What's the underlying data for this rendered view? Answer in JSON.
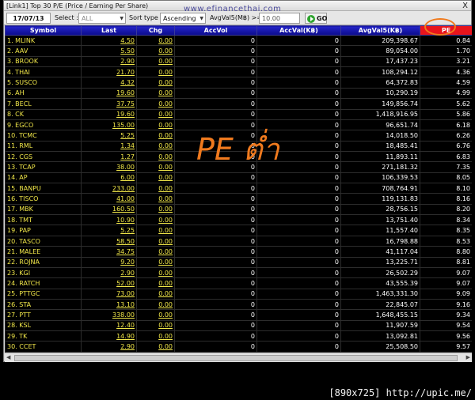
{
  "window": {
    "title": "[Link1] Top 30 P/E (Price / Earning Per Share)",
    "close": "X"
  },
  "watermark": "www.efinancethai.com",
  "toolbar": {
    "date": "17/07/13",
    "select_label": "Select :",
    "select_value": "ALL",
    "sort_label": "Sort type :",
    "sort_value": "Ascending",
    "avg_label": "AvgVal5(M฿) >=",
    "avg_value": "10.00",
    "go_label": "GO"
  },
  "table": {
    "columns": [
      "Symbol",
      "Last",
      "Chg",
      "AccVol",
      "AccVal(K฿)",
      "AvgVal5(K฿)",
      "PE"
    ],
    "rows": [
      [
        "1. MLINK",
        "4.50",
        "0.00",
        "0",
        "0",
        "209,398.67",
        "0.84"
      ],
      [
        "2. AAV",
        "5.50",
        "0.00",
        "0",
        "0",
        "89,054.00",
        "1.70"
      ],
      [
        "3. BROOK",
        "2.90",
        "0.00",
        "0",
        "0",
        "17,437.23",
        "3.21"
      ],
      [
        "4. THAI",
        "21.70",
        "0.00",
        "0",
        "0",
        "108,294.12",
        "4.36"
      ],
      [
        "5. SUSCO",
        "4.32",
        "0.00",
        "0",
        "0",
        "64,372.83",
        "4.59"
      ],
      [
        "6. AH",
        "19.60",
        "0.00",
        "0",
        "0",
        "10,290.19",
        "4.99"
      ],
      [
        "7. BECL",
        "37.75",
        "0.00",
        "0",
        "0",
        "149,856.74",
        "5.62"
      ],
      [
        "8. CK",
        "19.60",
        "0.00",
        "0",
        "0",
        "1,418,916.95",
        "5.86"
      ],
      [
        "9. EGCO",
        "135.00",
        "0.00",
        "0",
        "0",
        "96,651.74",
        "6.18"
      ],
      [
        "10. TCMC",
        "5.25",
        "0.00",
        "0",
        "0",
        "14,018.50",
        "6.26"
      ],
      [
        "11. RML",
        "1.34",
        "0.00",
        "0",
        "0",
        "18,485.41",
        "6.76"
      ],
      [
        "12. CGS",
        "1.27",
        "0.00",
        "0",
        "0",
        "11,893.11",
        "6.83"
      ],
      [
        "13. TCAP",
        "38.00",
        "0.00",
        "0",
        "0",
        "271,181.32",
        "7.35"
      ],
      [
        "14. AP",
        "6.00",
        "0.00",
        "0",
        "0",
        "106,339.53",
        "8.05"
      ],
      [
        "15. BANPU",
        "233.00",
        "0.00",
        "0",
        "0",
        "708,764.91",
        "8.10"
      ],
      [
        "16. TISCO",
        "41.00",
        "0.00",
        "0",
        "0",
        "119,131.83",
        "8.16"
      ],
      [
        "17. MBK",
        "160.50",
        "0.00",
        "0",
        "0",
        "28,756.15",
        "8.20"
      ],
      [
        "18. TMT",
        "10.90",
        "0.00",
        "0",
        "0",
        "13,751.40",
        "8.34"
      ],
      [
        "19. PAP",
        "5.25",
        "0.00",
        "0",
        "0",
        "11,557.40",
        "8.35"
      ],
      [
        "20. TASCO",
        "58.50",
        "0.00",
        "0",
        "0",
        "16,798.88",
        "8.53"
      ],
      [
        "21. MALEE",
        "34.75",
        "0.00",
        "0",
        "0",
        "41,117.04",
        "8.80"
      ],
      [
        "22. ROJNA",
        "9.20",
        "0.00",
        "0",
        "0",
        "13,225.71",
        "8.81"
      ],
      [
        "23. KGI",
        "2.90",
        "0.00",
        "0",
        "0",
        "26,502.29",
        "9.07"
      ],
      [
        "24. RATCH",
        "52.00",
        "0.00",
        "0",
        "0",
        "43,555.39",
        "9.07"
      ],
      [
        "25. PTTGC",
        "73.00",
        "0.00",
        "0",
        "0",
        "1,463,331.30",
        "9.09"
      ],
      [
        "26. STA",
        "13.10",
        "0.00",
        "0",
        "0",
        "22,845.07",
        "9.16"
      ],
      [
        "27. PTT",
        "338.00",
        "0.00",
        "0",
        "0",
        "1,648,455.15",
        "9.34"
      ],
      [
        "28. KSL",
        "12.40",
        "0.00",
        "0",
        "0",
        "11,907.59",
        "9.54"
      ],
      [
        "29. TK",
        "14.90",
        "0.00",
        "0",
        "0",
        "13,092.81",
        "9.56"
      ],
      [
        "30. CCET",
        "2.90",
        "0.00",
        "0",
        "0",
        "25,508.50",
        "9.57"
      ]
    ]
  },
  "annotation": "PE ต่ำ",
  "footer": "[890x725] http://upic.me/",
  "colors": {
    "header_bg": "#1414a8",
    "pe_header_bg": "#e8141c",
    "highlight_ring": "#f07a1e",
    "symbol_text": "#f2e84a"
  }
}
